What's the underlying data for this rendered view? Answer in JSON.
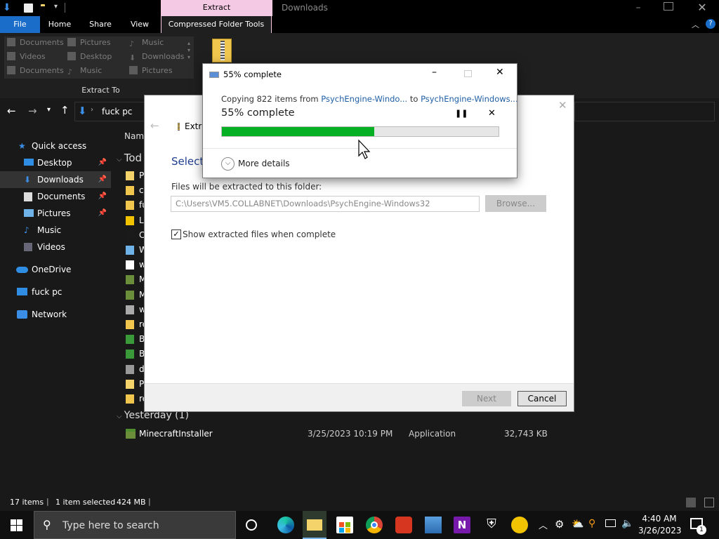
{
  "window": {
    "context_tab": "Extract",
    "title": "Downloads",
    "qat_items": [
      "down-arrow",
      "properties",
      "new-folder",
      "customize"
    ]
  },
  "ribbon_tabs": {
    "file": "File",
    "home": "Home",
    "share": "Share",
    "view": "View",
    "compressed": "Compressed Folder Tools"
  },
  "extract_to": {
    "items": [
      "Documents",
      "Pictures",
      "Music",
      "Videos",
      "Desktop",
      "Downloads",
      "Documents",
      "Music",
      "Pictures"
    ],
    "group_label": "Extract To"
  },
  "nav": {
    "path": "fuck pc"
  },
  "sidebar": {
    "items": [
      {
        "label": "Quick access"
      },
      {
        "label": "Desktop"
      },
      {
        "label": "Downloads"
      },
      {
        "label": "Documents"
      },
      {
        "label": "Pictures"
      },
      {
        "label": "Music"
      },
      {
        "label": "Videos"
      },
      {
        "label": "OneDrive"
      },
      {
        "label": "fuck pc"
      },
      {
        "label": "Network"
      }
    ]
  },
  "filelist": {
    "name_header": "Name",
    "group_today": "Tod",
    "today_truncated": [
      "P",
      "c",
      "fu",
      "Li",
      "C",
      "W",
      "w",
      "M",
      "M",
      "w",
      "re",
      "B",
      "B",
      "d",
      "P",
      "re"
    ],
    "group_yesterday": "Yesterday (1)",
    "yesterday_rows": [
      {
        "name": "MinecraftInstaller",
        "date": "3/25/2023 10:19 PM",
        "type": "Application",
        "size": "32,743 KB"
      }
    ]
  },
  "status": {
    "count": "17 items",
    "selected": "1 item selected",
    "size": "424 MB"
  },
  "extract_dialog": {
    "header": "Extra",
    "select_text": "Select",
    "dest_label": "Files will be extracted to this folder:",
    "dest_value": "C:\\Users\\VM5.COLLABNET\\Downloads\\PsychEngine-Windows32",
    "browse": "Browse...",
    "show_files": "Show extracted files when complete",
    "next": "Next",
    "cancel": "Cancel"
  },
  "progress_dialog": {
    "title": "55% complete",
    "copy_prefix": "Copying 822 items from",
    "source": "PsychEngine-Windo...",
    "to": "to",
    "dest": "PsychEngine-Windows...",
    "status": "55% complete",
    "progress": 0.55,
    "more_details": "More details"
  },
  "taskbar": {
    "search_placeholder": "Type here to search",
    "time": "4:40 AM",
    "date": "3/26/2023",
    "notif_count": "1"
  },
  "colors": {
    "progress_fill": "#06b025",
    "context_tab": "#f4c9e4",
    "link": "#1f5fa6",
    "file_tab": "#1a6dc9"
  }
}
